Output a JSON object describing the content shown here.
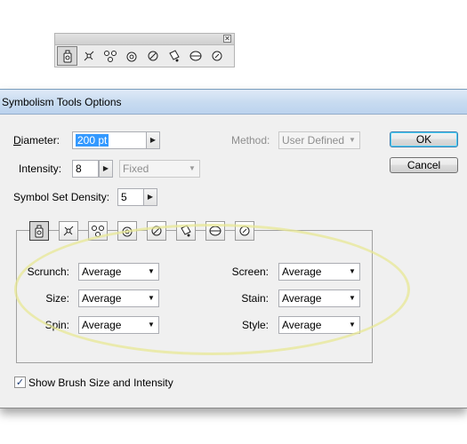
{
  "panel": {
    "close_glyph": "✕",
    "tools": [
      "symbol-sprayer-icon",
      "symbol-shifter-icon",
      "symbol-scruncher-icon",
      "symbol-sizer-icon",
      "symbol-spinner-icon",
      "symbol-stainer-icon",
      "symbol-screener-icon",
      "symbol-styler-icon"
    ]
  },
  "dialog": {
    "title": "Symbolism Tools Options",
    "diameter": {
      "label": "Diameter:",
      "value": "200 pt"
    },
    "method": {
      "label": "Method:",
      "value": "User Defined"
    },
    "intensity": {
      "label": "Intensity:",
      "value": "8",
      "mode": "Fixed"
    },
    "density": {
      "label": "Symbol Set Density:",
      "value": "5"
    },
    "ok_label": "OK",
    "cancel_label": "Cancel",
    "tools": [
      "symbol-sprayer-icon",
      "symbol-shifter-icon",
      "symbol-scruncher-icon",
      "symbol-sizer-icon",
      "symbol-spinner-icon",
      "symbol-stainer-icon",
      "symbol-screener-icon",
      "symbol-styler-icon"
    ],
    "options_left": [
      {
        "label": "Scrunch:",
        "value": "Average"
      },
      {
        "label": "Size:",
        "value": "Average"
      },
      {
        "label": "Spin:",
        "value": "Average"
      }
    ],
    "options_right": [
      {
        "label": "Screen:",
        "value": "Average"
      },
      {
        "label": "Stain:",
        "value": "Average"
      },
      {
        "label": "Style:",
        "value": "Average"
      }
    ],
    "show_brush": {
      "label": "Show Brush Size and Intensity",
      "checked": true
    }
  },
  "colors": {
    "title_bar": "#c7dbf0",
    "selection": "#3399ff",
    "highlight_ellipse": "#e8e896"
  }
}
